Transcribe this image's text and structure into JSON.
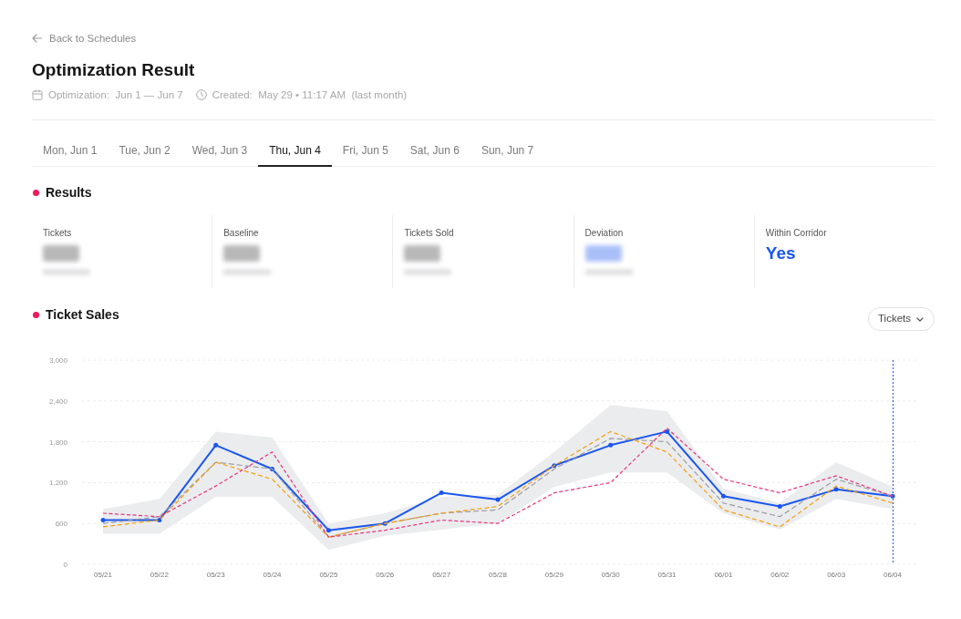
{
  "back_link": {
    "label": "Back to Schedules"
  },
  "title": "Optimization Result",
  "meta": [
    {
      "kind": "calendar",
      "text": "Optimization:  Jun 1 — Jun 7"
    },
    {
      "kind": "clock",
      "text": "Created:  May 29 • 11:17 AM  (last month)"
    }
  ],
  "tabs": [
    {
      "label": "Mon, Jun 1",
      "selected": false
    },
    {
      "label": "Tue, Jun 2",
      "selected": false
    },
    {
      "label": "Wed, Jun 3",
      "selected": false
    },
    {
      "label": "Thu, Jun 4",
      "selected": true
    },
    {
      "label": "Fri, Jun 5",
      "selected": false
    },
    {
      "label": "Sat, Jun 6",
      "selected": false
    },
    {
      "label": "Sun, Jun 7",
      "selected": false
    }
  ],
  "results": {
    "title": "Results",
    "metrics": [
      {
        "label": "Tickets",
        "kind": "hidden",
        "color": "#b8b8b8"
      },
      {
        "label": "Baseline",
        "kind": "hidden",
        "color": "#b8b8b8"
      },
      {
        "label": "Tickets Sold",
        "kind": "hidden",
        "color": "#b8b8b8"
      },
      {
        "label": "Deviation",
        "kind": "hidden",
        "color": "#a9bff8"
      },
      {
        "label": "Within Corridor",
        "kind": "shown",
        "color": "#1a56f0",
        "value": "Yes"
      }
    ]
  },
  "ticket_sales": {
    "title": "Ticket Sales",
    "metric_select": "Tickets",
    "chart_data": {
      "type": "line",
      "categories": [
        "05/21",
        "05/22",
        "05/23",
        "05/24",
        "05/25",
        "05/26",
        "05/27",
        "05/28",
        "05/29",
        "05/30",
        "05/31",
        "06/01",
        "06/02",
        "06/03",
        "06/04"
      ],
      "ylim": [
        0,
        3000
      ],
      "yticks": [
        0,
        600,
        {
          "value": 1200,
          "label": "1,200"
        },
        {
          "value": 1800,
          "label": "1,800"
        },
        {
          "value": 2400,
          "label": "2,400"
        },
        {
          "value": 3000,
          "label": "3,000"
        }
      ],
      "grid": true,
      "series": [
        {
          "color": "#9a9ca3",
          "line_style": "dashed",
          "values": [
            600,
            700,
            1500,
            1400,
            400,
            600,
            750,
            800,
            1400,
            1850,
            1800,
            900,
            700,
            1250,
            1000
          ]
        },
        {
          "color": "#f59e0b",
          "line_style": "dashed",
          "values": [
            550,
            650,
            1500,
            1250,
            400,
            600,
            750,
            850,
            1450,
            1950,
            1650,
            800,
            550,
            1150,
            900
          ]
        },
        {
          "color": "#e8337f",
          "line_style": "dashed",
          "values": [
            750,
            700,
            1150,
            1650,
            400,
            500,
            650,
            600,
            1050,
            1200,
            2000,
            1250,
            1050,
            1300,
            1000
          ]
        },
        {
          "color": "#1a56f0",
          "line_style": "solid",
          "values": [
            650,
            650,
            1750,
            1400,
            500,
            600,
            1050,
            950,
            1450,
            1750,
            1950,
            1000,
            850,
            1100,
            1000
          ]
        }
      ],
      "ref_lines": [
        {
          "axis": "x",
          "value": "06/04",
          "color": "#1a56f0"
        }
      ]
    }
  }
}
